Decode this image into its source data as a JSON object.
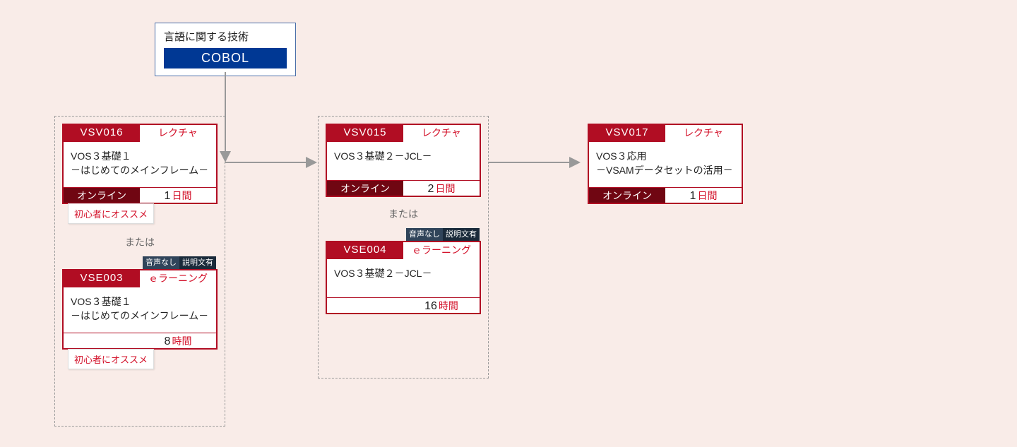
{
  "category": {
    "title": "言語に関する技術",
    "badge": "COBOL"
  },
  "labels": {
    "or": "または",
    "recommend": "初心者にオススメ",
    "tag_a": "音声なし",
    "tag_b": "説明文有"
  },
  "cards": {
    "c1": {
      "code": "VSV016",
      "type": "レクチャ",
      "title": "VOS３基礎１\n－はじめてのメインフレーム－",
      "mode": "オンライン",
      "dur_num": "1",
      "dur_unit": "日間"
    },
    "c2": {
      "code": "VSE003",
      "type": "ｅラーニング",
      "title": "VOS３基礎１\n－はじめてのメインフレーム－",
      "mode": "",
      "dur_num": "8",
      "dur_unit": "時間"
    },
    "c3": {
      "code": "VSV015",
      "type": "レクチャ",
      "title": "VOS３基礎２－JCL－",
      "mode": "オンライン",
      "dur_num": "2",
      "dur_unit": "日間"
    },
    "c4": {
      "code": "VSE004",
      "type": "ｅラーニング",
      "title": "VOS３基礎２－JCL－",
      "mode": "",
      "dur_num": "16",
      "dur_unit": "時間"
    },
    "c5": {
      "code": "VSV017",
      "type": "レクチャ",
      "title": "VOS３応用\n－VSAMデータセットの活用－",
      "mode": "オンライン",
      "dur_num": "1",
      "dur_unit": "日間"
    }
  }
}
